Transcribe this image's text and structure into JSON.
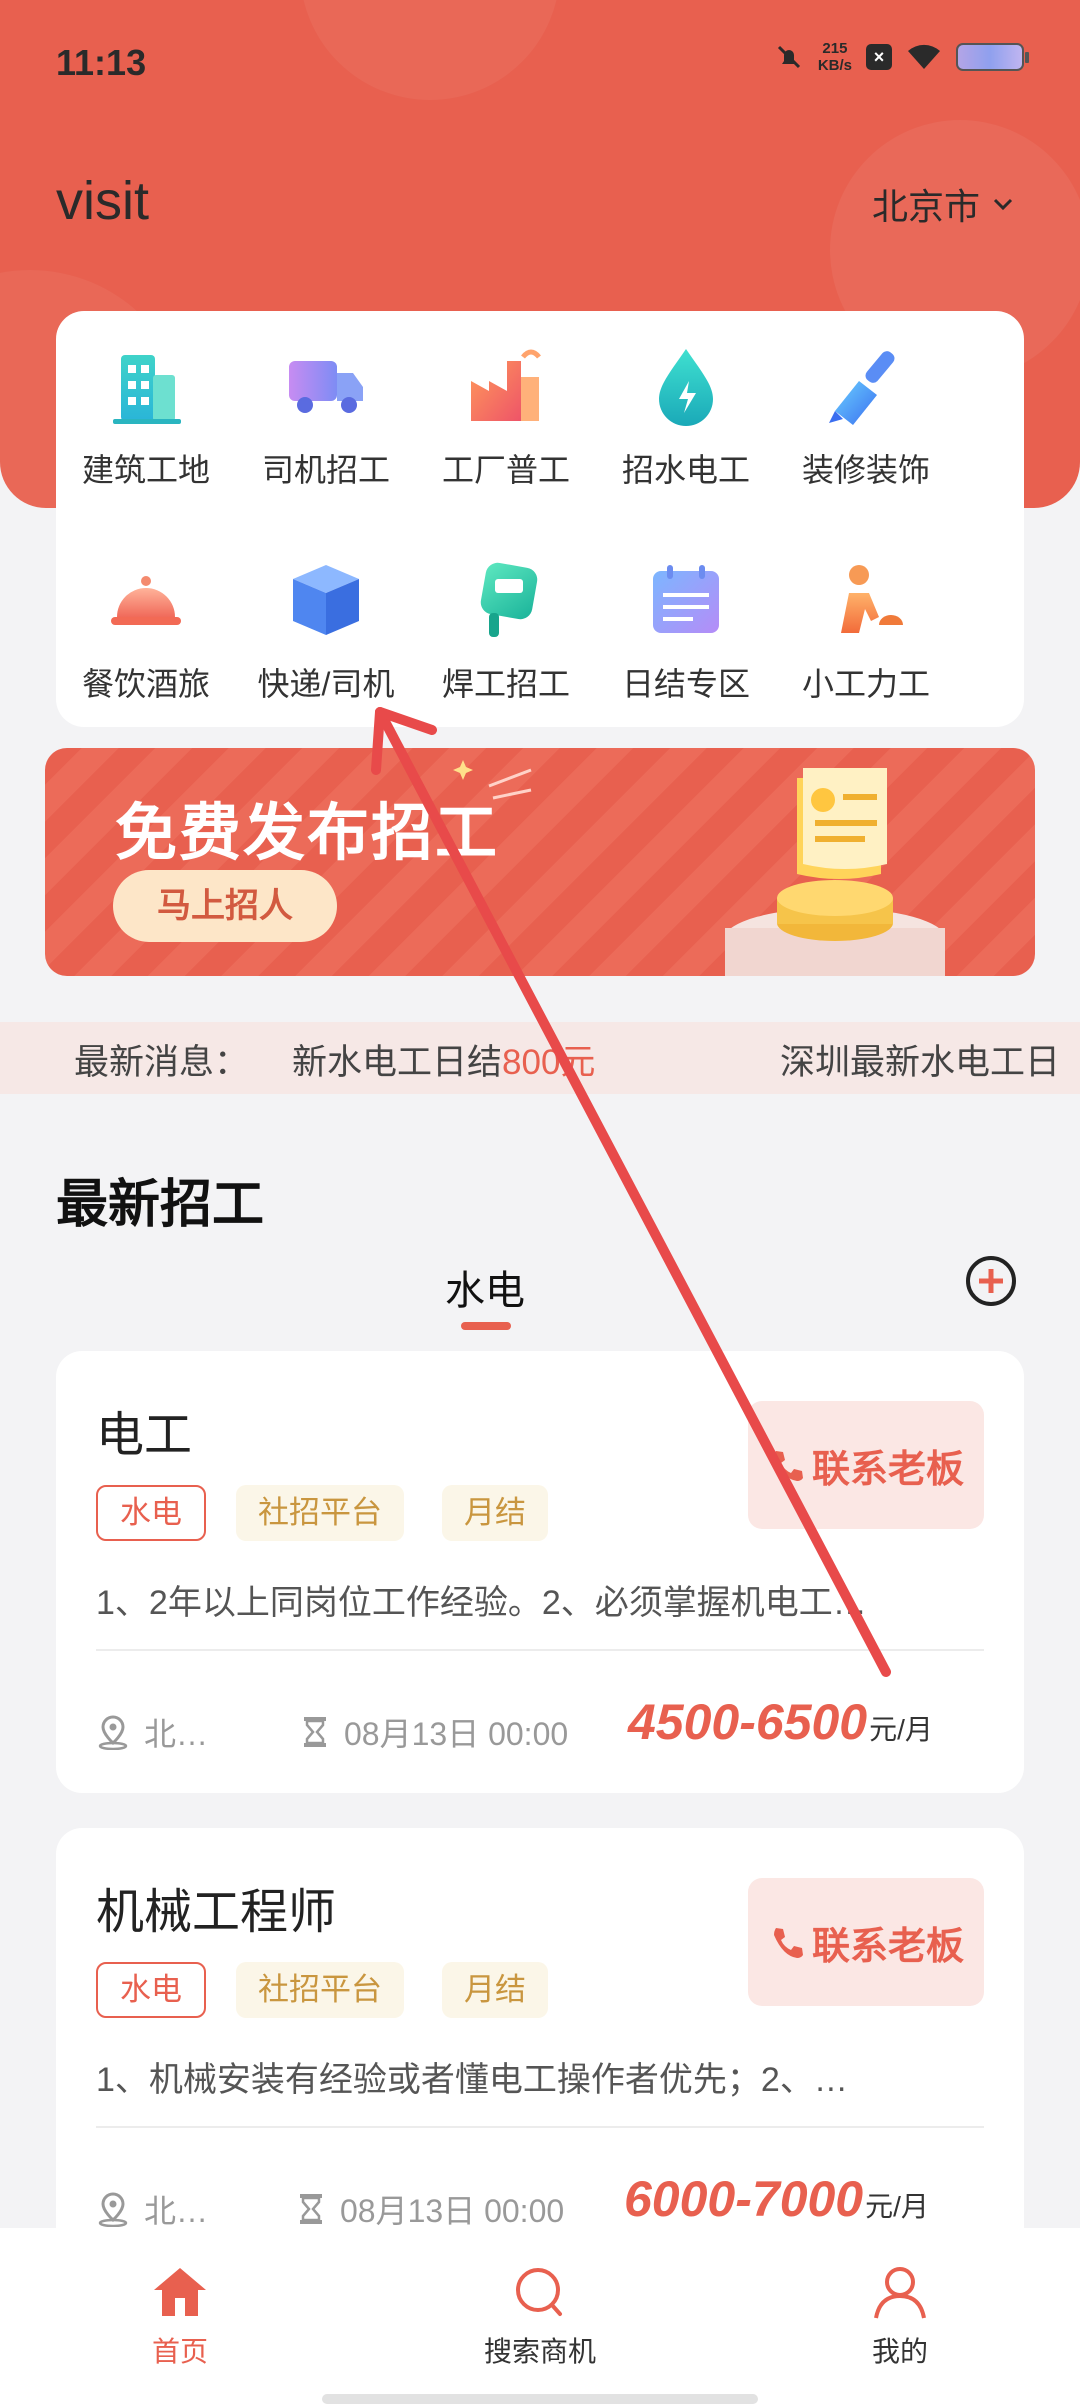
{
  "status_bar": {
    "time": "11:13",
    "speed_value": "215",
    "speed_unit": "KB/s"
  },
  "header": {
    "app_title": "visit",
    "city": "北京市"
  },
  "categories": [
    {
      "label": "建筑工地",
      "icon": "building-icon"
    },
    {
      "label": "司机招工",
      "icon": "truck-icon"
    },
    {
      "label": "工厂普工",
      "icon": "factory-icon"
    },
    {
      "label": "招水电工",
      "icon": "water-electric-icon"
    },
    {
      "label": "装修装饰",
      "icon": "paint-brush-icon"
    },
    {
      "label": "餐饮酒旅",
      "icon": "food-cloche-icon"
    },
    {
      "label": "快递/司机",
      "icon": "package-box-icon"
    },
    {
      "label": "焊工招工",
      "icon": "welding-icon"
    },
    {
      "label": "日结专区",
      "icon": "calendar-icon"
    },
    {
      "label": "小工力工",
      "icon": "worker-icon"
    }
  ],
  "banner": {
    "title": "免费发布招工",
    "button": "马上招人"
  },
  "news": {
    "label": "最新消息：",
    "item1_prefix": "新水电工日结",
    "item1_amount": "800元",
    "item2": "深圳最新水电工日"
  },
  "section": {
    "title": "最新招工",
    "active_tab": "水电"
  },
  "jobs": [
    {
      "title": "电工",
      "tags": [
        "水电",
        "社招平台",
        "月结"
      ],
      "desc": "1、2年以上同岗位工作经验。2、必须掌握机电工…",
      "location": "北…",
      "date": "08月13日 00:00",
      "salary": "4500-6500",
      "unit": "元/月",
      "contact": "联系老板"
    },
    {
      "title": "机械工程师",
      "tags": [
        "水电",
        "社招平台",
        "月结"
      ],
      "desc": "1、机械安装有经验或者懂电工操作者优先；2、…",
      "location": "北…",
      "date": "08月13日 00:00",
      "salary": "6000-7000",
      "unit": "元/月",
      "contact": "联系老板"
    }
  ],
  "tabbar": {
    "home": "首页",
    "search": "搜索商机",
    "mine": "我的"
  },
  "colors": {
    "accent": "#e8604f",
    "background": "#f3f3f5",
    "tag_gold": "#c9963f"
  }
}
